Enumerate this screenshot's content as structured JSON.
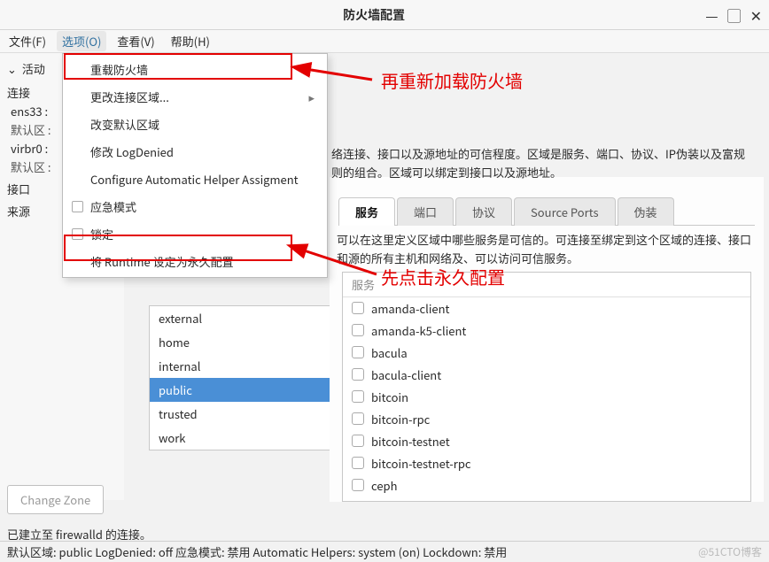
{
  "window": {
    "title": "防火墙配置"
  },
  "menubar": {
    "items": [
      {
        "label": "文件(F)"
      },
      {
        "label": "选项(O)"
      },
      {
        "label": "查看(V)"
      },
      {
        "label": "帮助(H)"
      }
    ]
  },
  "dropdown": {
    "items": [
      {
        "type": "plain",
        "label": "重载防火墙"
      },
      {
        "type": "submenu",
        "label": "更改连接区域..."
      },
      {
        "type": "plain",
        "label": "改变默认区域"
      },
      {
        "type": "plain",
        "label": "修改 LogDenied"
      },
      {
        "type": "plain",
        "label": "Configure Automatic Helper Assigment"
      },
      {
        "type": "check",
        "label": "应急模式"
      },
      {
        "type": "check",
        "label": "锁定"
      },
      {
        "type": "plain",
        "label": "将 Runtime 设定为永久配置"
      }
    ]
  },
  "annotations": {
    "top": "再重新加载防火墙",
    "bottom": "先点击永久配置"
  },
  "left": {
    "active_header": "活动",
    "conn_label": "连接",
    "ifaces": [
      {
        "name": "ens33 :",
        "zone": "默认区 :"
      },
      {
        "name": "virbr0 :",
        "zone": "默认区 :"
      }
    ],
    "iface_label": "接口",
    "source_label": "来源",
    "change_zone_btn": "Change Zone"
  },
  "zones": [
    "external",
    "home",
    "internal",
    "public",
    "trusted",
    "work"
  ],
  "zone_selected": "public",
  "right": {
    "desc": "络连接、接口以及源地址的可信程度。区域是服务、端口、协议、IP伪装以及富规则的组合。区域可以绑定到接口以及源地址。",
    "tabs": [
      "服务",
      "端口",
      "协议",
      "Source Ports",
      "伪装"
    ],
    "svc_desc": "可以在这里定义区域中哪些服务是可信的。可连接至绑定到这个区域的连接、接口和源的所有主机和网络及、可以访问可信服务。",
    "svc_header": "服务",
    "services": [
      "amanda-client",
      "amanda-k5-client",
      "bacula",
      "bacula-client",
      "bitcoin",
      "bitcoin-rpc",
      "bitcoin-testnet",
      "bitcoin-testnet-rpc",
      "ceph"
    ]
  },
  "status": {
    "line1": "已建立至 firewalld 的连接。",
    "line2": "默认区域: public  LogDenied: off  应急模式: 禁用  Automatic Helpers: system (on)  Lockdown: 禁用",
    "watermark": "@51CTO博客"
  }
}
